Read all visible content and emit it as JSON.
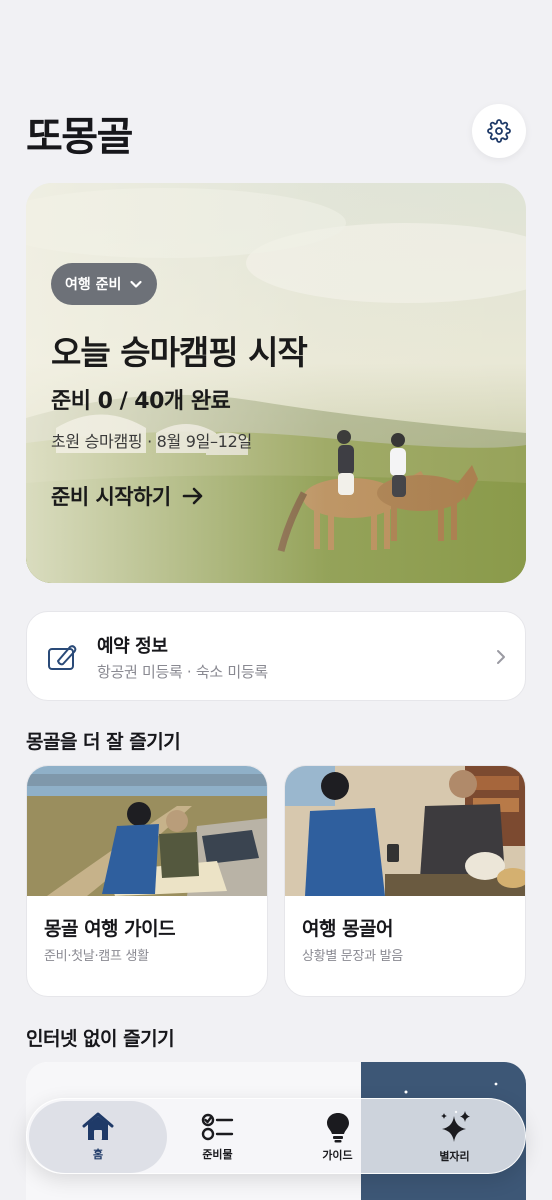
{
  "header": {
    "title": "또몽골"
  },
  "hero": {
    "trip_selector": "여행 준비",
    "title": "오늘 승마캠핑 시작",
    "progress": "준비 0 / 40개 완료",
    "subtitle": "초원 승마캠핑 · 8월 9일–12일",
    "cta": "준비 시작하기"
  },
  "reservation": {
    "title": "예약 정보",
    "subtitle": "항공권 미등록 · 숙소 미등록"
  },
  "enjoy_section": {
    "title": "몽골을 더 잘 즐기기",
    "cards": [
      {
        "title": "몽골 여행 가이드",
        "subtitle": "준비·첫날·캠프 생활"
      },
      {
        "title": "여행 몽골어",
        "subtitle": "상황별 문장과 발음"
      }
    ]
  },
  "offline_section": {
    "title": "인터넷 없이 즐기기"
  },
  "bottom_nav": {
    "items": [
      {
        "label": "홈",
        "icon": "home-icon",
        "active": true
      },
      {
        "label": "준비물",
        "icon": "checklist-icon",
        "active": false
      },
      {
        "label": "가이드",
        "icon": "lightbulb-icon",
        "active": false
      },
      {
        "label": "별자리",
        "icon": "sparkles-icon",
        "active": false
      }
    ]
  },
  "colors": {
    "accent": "#1f3a68",
    "background": "#f1f1f4",
    "pill": "#6d7178"
  }
}
